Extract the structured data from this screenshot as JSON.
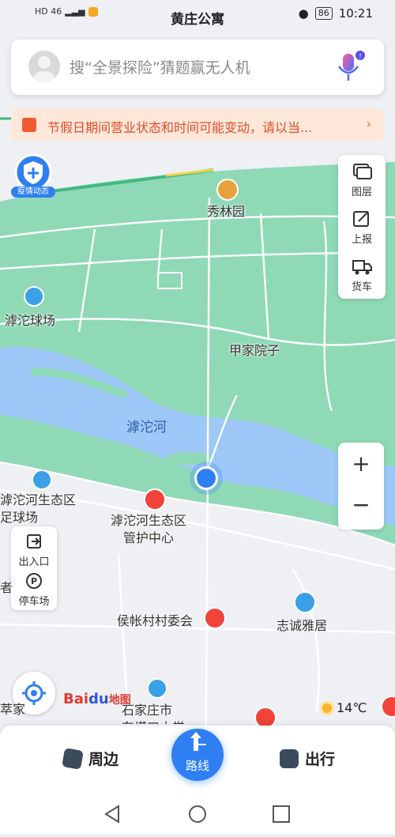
{
  "status_bar": {
    "left_text": "HD 46",
    "location_title": "黄庄公寓",
    "battery": "86",
    "time": "10:21"
  },
  "search": {
    "placeholder": "搜“全景探险”猜题赢无人机"
  },
  "notice": {
    "text": "节假日期间营业状态和时间可能变动，请以当..."
  },
  "badge": {
    "label": "疫情动态"
  },
  "map_tools": {
    "layers": "图层",
    "report": "上报",
    "truck": "货车"
  },
  "zoom": {
    "in": "+",
    "out": "−"
  },
  "left_tools": {
    "entrance": "出入口",
    "parking": "停车场"
  },
  "map_labels": {
    "xiulinyuan": "秀林园",
    "hutuo_court": "滹沱球场",
    "jiajiayuanzi": "甲家院子",
    "hutuo_river": "滹沱河",
    "eco_football": "滹沱河生态区\n足球场",
    "eco_center": "滹沱河生态区\n管护中心",
    "houzhang_village": "侯帐村村委会",
    "zhicheng": "志诚雅居",
    "school": "石家庄市\n东塔口小学",
    "partial_left_1": "者",
    "partial_left_2": "萃家"
  },
  "map_logo": {
    "bai": "Bai",
    "du": "du",
    "suffix": "地图"
  },
  "weather": {
    "temp": "14℃"
  },
  "bottom_bar": {
    "nearby": "周边",
    "route": "路线",
    "travel": "出行"
  },
  "colors": {
    "accent": "#2f7ff3",
    "park_green": "#8fd9b6",
    "river_blue": "#9ec8f7",
    "notice_red": "#e04b2b",
    "poi_red": "#f0433a"
  }
}
